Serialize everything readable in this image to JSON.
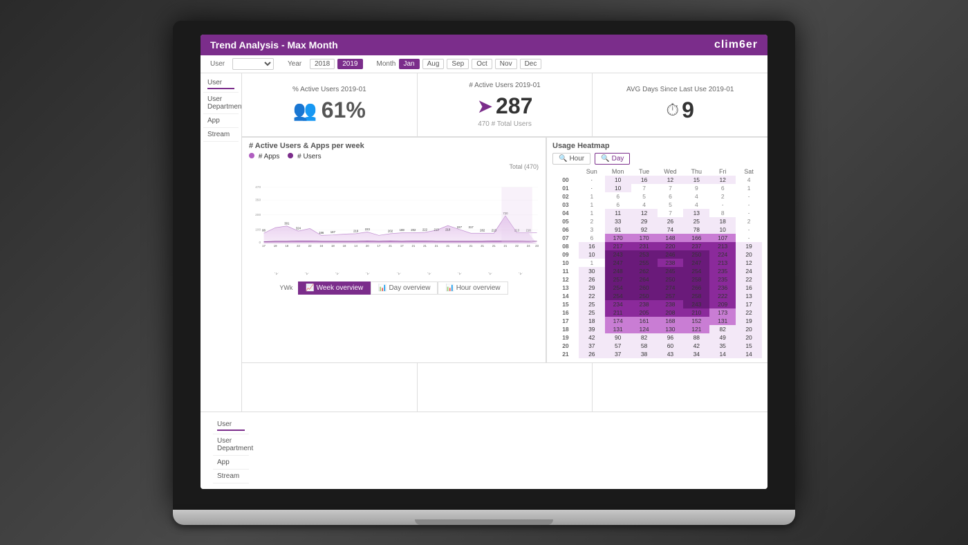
{
  "header": {
    "title": "Trend Analysis - Max Month",
    "logo": "clim6er"
  },
  "filters": {
    "user_label": "User",
    "user_dept_label": "User Department",
    "app_label": "App",
    "stream_label": "Stream",
    "year_label": "Year",
    "year_options": [
      "2018",
      "2019"
    ],
    "year_active": "2019",
    "month_label": "Month",
    "months": [
      "Jan",
      "Aug",
      "Sep",
      "Oct",
      "Nov",
      "Dec"
    ]
  },
  "kpis": {
    "active_pct": {
      "label": "% Active Users 2019-01",
      "value": "61%",
      "icon": "👥"
    },
    "active_count": {
      "label": "# Active Users 2019-01",
      "value": "287",
      "sub": "470 # Total Users"
    },
    "avg_days": {
      "label": "AVG Days Since Last Use 2019-01",
      "value": "9"
    }
  },
  "chart": {
    "title": "# Active Users & Apps per week",
    "legend": [
      "# Apps",
      "# Users"
    ],
    "total_label": "Total (470)",
    "tabs": [
      "Week overview",
      "Day overview",
      "Hour overview"
    ],
    "active_tab": "Week overview",
    "yWk_label": "YWk",
    "data_points": [
      {
        "x": "2018-53",
        "users": 17,
        "apps": 88
      },
      {
        "x": "2019-00",
        "users": 19,
        "apps": 261
      },
      {
        "x": "2019-01",
        "users": 18,
        "apps": 301
      },
      {
        "x": "2019-02",
        "users": 22,
        "apps": 324
      },
      {
        "x": "2019-03",
        "users": 22,
        "apps": 159
      },
      {
        "x": "2019-04",
        "users": 16,
        "apps": 178
      },
      {
        "x": "2019-05",
        "users": 18,
        "apps": 186
      },
      {
        "x": "2019-06",
        "users": 18,
        "apps": 187
      },
      {
        "x": "2019-07",
        "users": 14,
        "apps": 219
      },
      {
        "x": "2019-08",
        "users": 20,
        "apps": 223
      },
      {
        "x": "2019-09",
        "users": 17,
        "apps": 202
      },
      {
        "x": "2019-10",
        "users": 21,
        "apps": 188
      },
      {
        "x": "2019-11",
        "users": 17,
        "apps": 202
      },
      {
        "x": "2019-12",
        "users": 21,
        "apps": 222
      },
      {
        "x": "2019-13",
        "users": 21,
        "apps": 213
      },
      {
        "x": "2019-14",
        "users": 21,
        "apps": 210
      },
      {
        "x": "2019-15",
        "users": 21,
        "apps": 227
      },
      {
        "x": "2019-16",
        "users": 21,
        "apps": 317
      },
      {
        "x": "2019-17",
        "users": 21,
        "apps": 282
      },
      {
        "x": "2019-18",
        "users": 21,
        "apps": 213
      },
      {
        "x": "2019-19",
        "users": 21,
        "apps": 120
      },
      {
        "x": "2019-20",
        "users": 24,
        "apps": 720
      },
      {
        "x": "2019-21",
        "users": 22,
        "apps": 213
      },
      {
        "x": "2019-22",
        "users": 24,
        "apps": 216
      },
      {
        "x": "2019-23",
        "users": 23,
        "apps": 14
      }
    ]
  },
  "heatmap": {
    "title": "Usage Heatmap",
    "controls": [
      "Hour",
      "Day"
    ],
    "active_control": "Day",
    "days": [
      "Sun",
      "Mon",
      "Tue",
      "Wed",
      "Thu",
      "Fri",
      "Sat"
    ],
    "rows": [
      {
        "hour": "00",
        "sun": "·",
        "mon": 10,
        "tue": 16,
        "wed": 12,
        "thu": 15,
        "fri": 12,
        "sat": 4
      },
      {
        "hour": "01",
        "sun": "·",
        "mon": 10,
        "tue": 7,
        "wed": 7,
        "thu": 9,
        "fri": 6,
        "sat": 1
      },
      {
        "hour": "02",
        "sun": 1,
        "mon": 6,
        "tue": 5,
        "wed": 6,
        "thu": 4,
        "fri": 2,
        "sat": "·"
      },
      {
        "hour": "03",
        "sun": 1,
        "mon": 6,
        "tue": 4,
        "wed": 5,
        "thu": 4,
        "fri": "·",
        "sat": "·"
      },
      {
        "hour": "04",
        "sun": 1,
        "mon": 11,
        "tue": 12,
        "wed": 7,
        "thu": 13,
        "fri": 8,
        "sat": "·"
      },
      {
        "hour": "05",
        "sun": 2,
        "mon": 33,
        "tue": 29,
        "wed": 26,
        "thu": 25,
        "fri": 18,
        "sat": 2
      },
      {
        "hour": "06",
        "sun": 3,
        "mon": 91,
        "tue": 92,
        "wed": 74,
        "thu": 78,
        "fri": 10,
        "sat": "·"
      },
      {
        "hour": "07",
        "sun": 6,
        "mon": 170,
        "tue": 170,
        "wed": 148,
        "thu": 166,
        "fri": 107,
        "sat": "·"
      },
      {
        "hour": "08",
        "sun": 16,
        "mon": 217,
        "tue": 231,
        "wed": 220,
        "thu": 237,
        "fri": 213,
        "sat": 19
      },
      {
        "hour": "09",
        "sun": 10,
        "mon": 243,
        "tue": 253,
        "wed": 246,
        "thu": 250,
        "fri": 224,
        "sat": 20
      },
      {
        "hour": "10",
        "sun": 1,
        "mon": 247,
        "tue": 255,
        "wed": 238,
        "thu": 247,
        "fri": 213,
        "sat": 12
      },
      {
        "hour": "11",
        "sun": 30,
        "mon": 248,
        "tue": 262,
        "wed": 245,
        "thu": 254,
        "fri": 235,
        "sat": 24
      },
      {
        "hour": "12",
        "sun": 26,
        "mon": 257,
        "tue": 264,
        "wed": 250,
        "thu": 258,
        "fri": 235,
        "sat": 22
      },
      {
        "hour": "13",
        "sun": 29,
        "mon": 254,
        "tue": 260,
        "wed": 274,
        "thu": 266,
        "fri": 236,
        "sat": 16
      },
      {
        "hour": "14",
        "sun": 22,
        "mon": 254,
        "tue": 250,
        "wed": 257,
        "thu": 258,
        "fri": 222,
        "sat": 13
      },
      {
        "hour": "15",
        "sun": 25,
        "mon": 234,
        "tue": 238,
        "wed": 238,
        "thu": 243,
        "fri": 209,
        "sat": 17
      },
      {
        "hour": "16",
        "sun": 25,
        "mon": 211,
        "tue": 205,
        "wed": 208,
        "thu": 210,
        "fri": 173,
        "sat": 22
      },
      {
        "hour": "17",
        "sun": 18,
        "mon": 174,
        "tue": 161,
        "wed": 168,
        "thu": 152,
        "fri": 131,
        "sat": 19
      },
      {
        "hour": "18",
        "sun": 39,
        "mon": 131,
        "tue": 124,
        "wed": 130,
        "thu": 121,
        "fri": 82,
        "sat": 20
      },
      {
        "hour": "19",
        "sun": 42,
        "mon": 90,
        "tue": 82,
        "wed": 96,
        "thu": 88,
        "fri": 49,
        "sat": 20
      },
      {
        "hour": "20",
        "sun": 37,
        "mon": 57,
        "tue": 58,
        "wed": 60,
        "thu": 42,
        "fri": 35,
        "sat": 15
      },
      {
        "hour": "21",
        "sun": 26,
        "mon": 37,
        "tue": 38,
        "wed": 43,
        "thu": 34,
        "fri": 14,
        "sat": 14
      }
    ]
  }
}
